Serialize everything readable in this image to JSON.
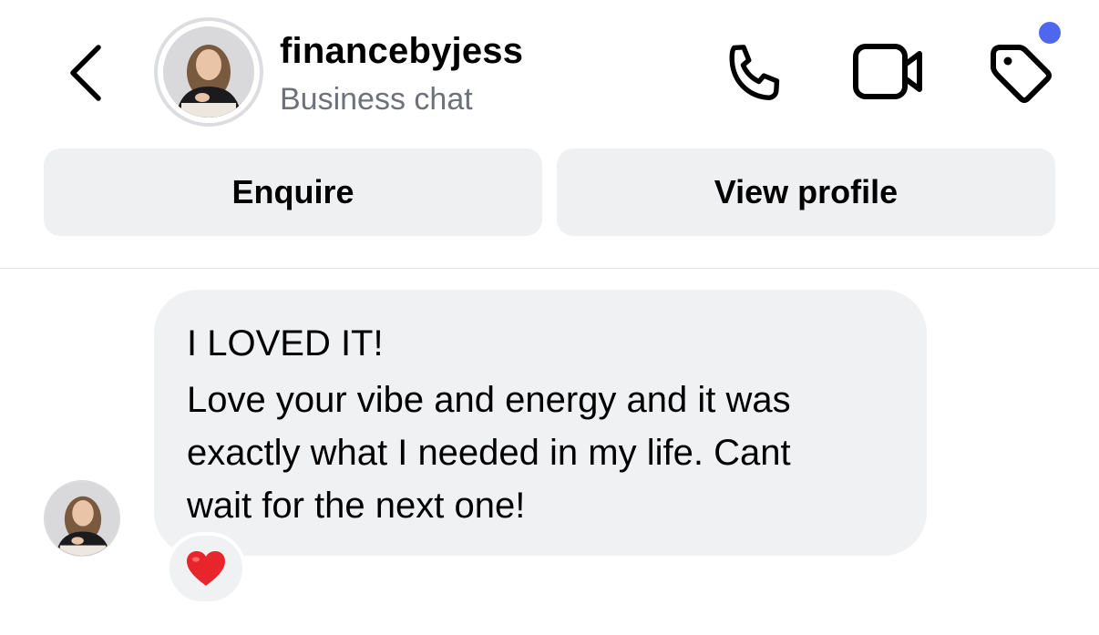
{
  "header": {
    "username": "financebyjess",
    "subtitle": "Business chat",
    "icons": {
      "back": "chevron-left-icon",
      "call": "phone-icon",
      "video": "video-camera-icon",
      "label": "tag-icon"
    },
    "notification_dot_color": "#4f66ee"
  },
  "actions": {
    "enquire_label": "Enquire",
    "view_profile_label": "View profile"
  },
  "message": {
    "line1": "I LOVED IT!",
    "line2": "Love your vibe and energy and it was",
    "line3": "exactly what I needed in my life. Cant",
    "line4": "wait for the next one!",
    "reaction": "❤️"
  },
  "colors": {
    "bubble_bg": "#f0f1f3",
    "button_bg": "#eff0f2",
    "subtitle_text": "#6e7179"
  }
}
